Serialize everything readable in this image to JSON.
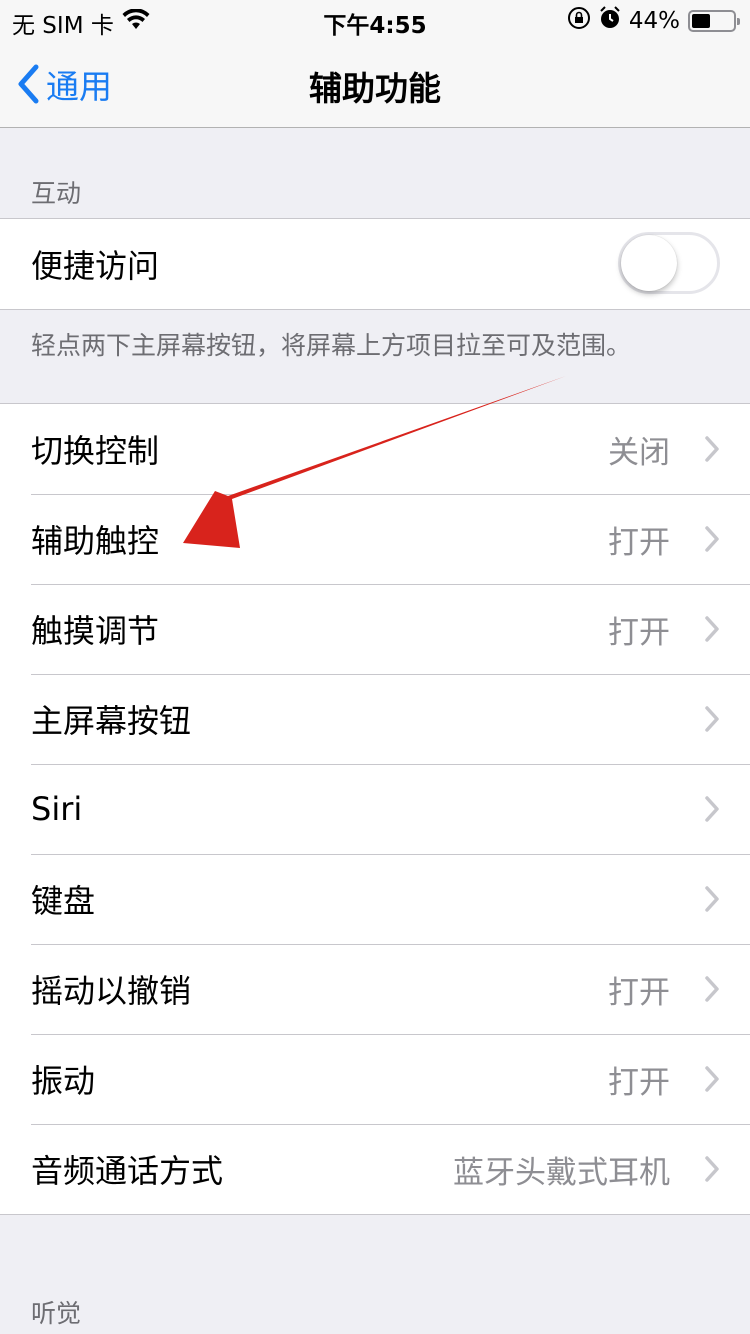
{
  "status_bar": {
    "carrier": "无 SIM 卡",
    "time": "下午4:55",
    "battery_percent": "44%",
    "battery_level": 0.44,
    "icons": [
      "wifi-icon",
      "orientation-lock-icon",
      "alarm-icon",
      "battery-icon"
    ]
  },
  "nav": {
    "back_label": "通用",
    "title": "辅助功能"
  },
  "sections": {
    "interaction_header": "互动",
    "reachability": {
      "label": "便捷访问",
      "toggle_on": false,
      "footer": "轻点两下主屏幕按钮，将屏幕上方项目拉至可及范围。"
    },
    "items": [
      {
        "label": "切换控制",
        "value": "关闭"
      },
      {
        "label": "辅助触控",
        "value": "打开"
      },
      {
        "label": "触摸调节",
        "value": "打开"
      },
      {
        "label": "主屏幕按钮",
        "value": ""
      },
      {
        "label": "Siri",
        "value": ""
      },
      {
        "label": "键盘",
        "value": ""
      },
      {
        "label": "摇动以撤销",
        "value": "打开"
      },
      {
        "label": "振动",
        "value": "打开"
      },
      {
        "label": "音频通话方式",
        "value": "蓝牙头戴式耳机"
      }
    ],
    "hearing_header": "听觉"
  },
  "annotation": {
    "color": "#d8231c",
    "points_to": "辅助触控"
  },
  "colors": {
    "accent": "#1a7cf2",
    "background": "#efeff4",
    "secondary_text": "#8e8e93"
  }
}
